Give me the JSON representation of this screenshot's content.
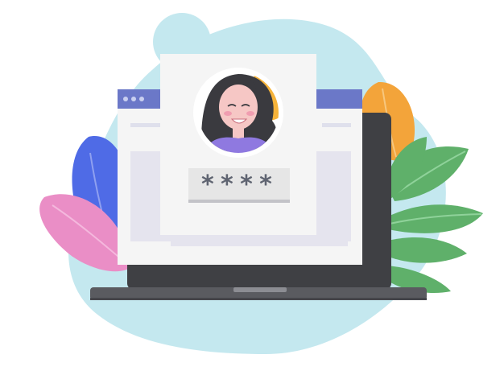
{
  "login": {
    "password_mask": "****"
  },
  "colors": {
    "blob": "#c4e8ef",
    "laptop_body": "#3f4044",
    "laptop_base": "#5a5b60",
    "browser_bar": "#6b78c8",
    "card": "#f5f5f5",
    "avatar_ring": "#ffffff",
    "avatar_sun": "#f6b33a",
    "hair": "#3a3a3f",
    "shirt": "#8f79e0",
    "leaf_blue": "#4f6be6",
    "leaf_pink": "#ea8ec6",
    "leaf_orange": "#f3a43a",
    "leaf_green": "#5fb06a"
  },
  "icons": [
    "window-dots-icon",
    "user-avatar-icon",
    "leaf-icon"
  ]
}
